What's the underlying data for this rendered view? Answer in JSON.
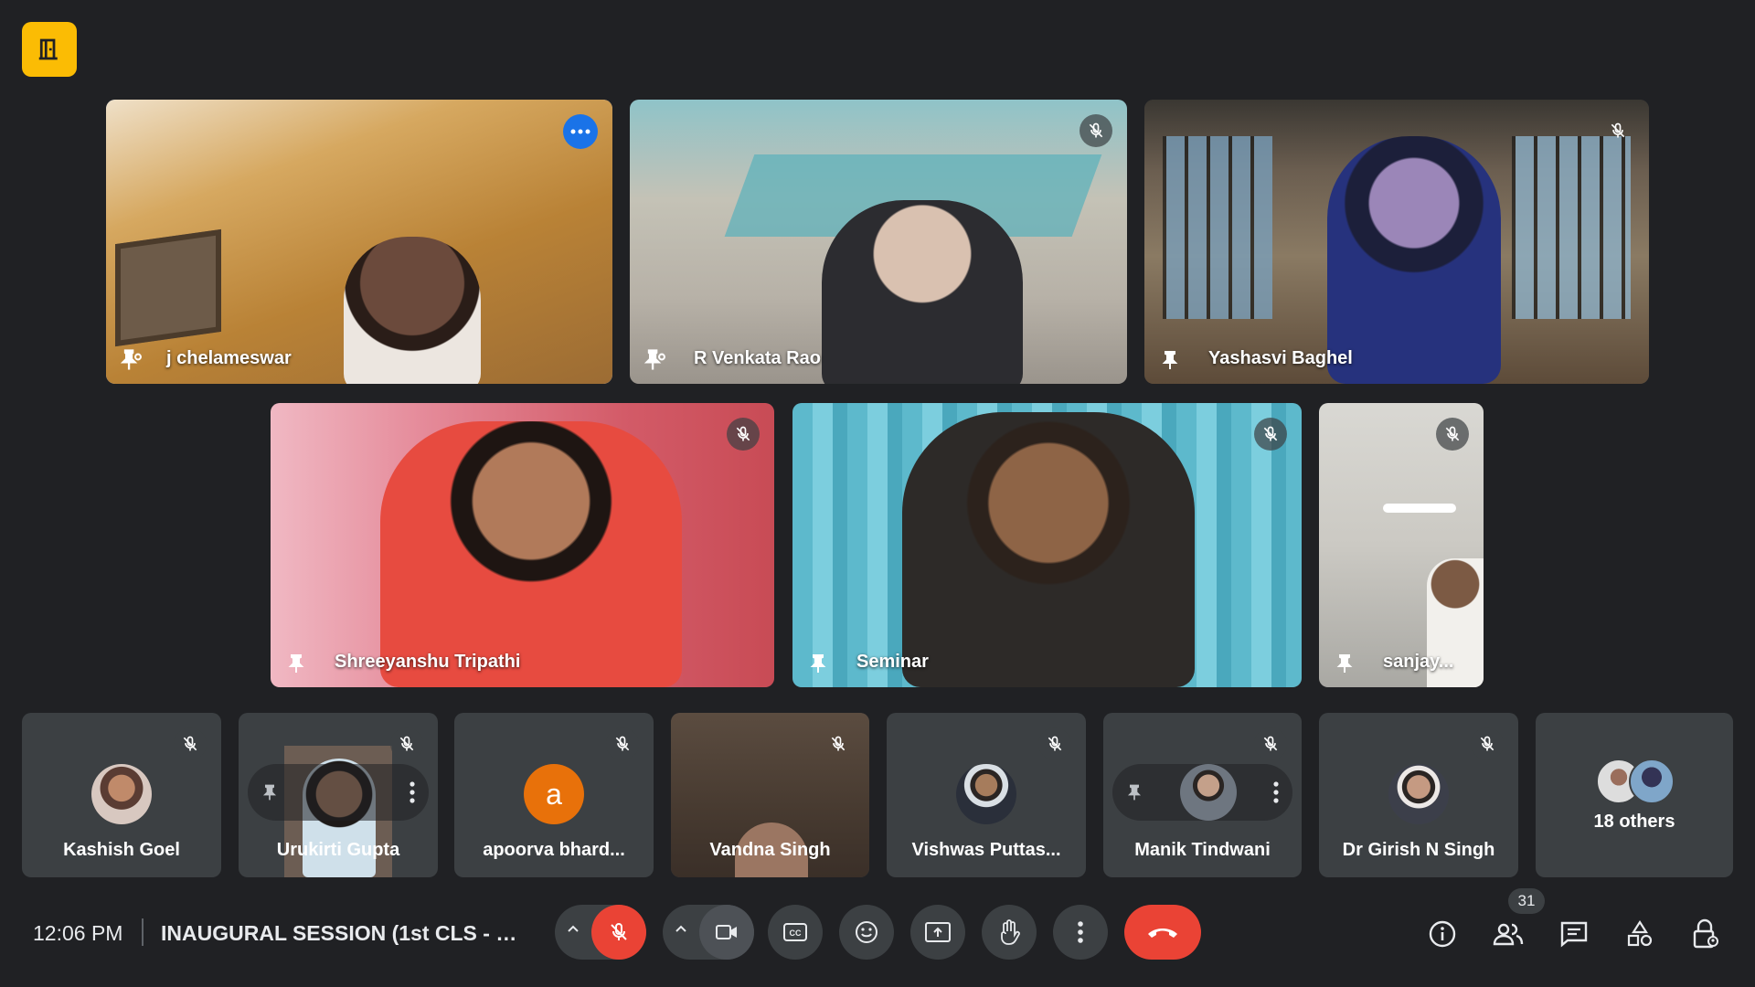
{
  "app": {
    "logo_icon": "activities-door-icon"
  },
  "stage": {
    "tiles": [
      {
        "name": "j chelameswar",
        "state": "speaking-active"
      },
      {
        "name": "R Venkata Rao",
        "state": "muted"
      },
      {
        "name": "Yashasvi Baghel",
        "state": "muted"
      },
      {
        "name": "Shreeyanshu Tripathi",
        "state": "muted"
      },
      {
        "name": "Seminar",
        "state": "muted"
      },
      {
        "name": "sanjay...",
        "state": "muted"
      }
    ]
  },
  "strip": {
    "tiles": [
      {
        "name": "Kashish Goel"
      },
      {
        "name": "Urukirti Gupta"
      },
      {
        "name": "apoorva bhard...",
        "avatar_letter": "a"
      },
      {
        "name": "Vandna Singh"
      },
      {
        "name": "Vishwas Puttas..."
      },
      {
        "name": "Manik Tindwani"
      },
      {
        "name": "Dr Girish N Singh"
      }
    ],
    "others_label": "18 others"
  },
  "bottom": {
    "time": "12:06 PM",
    "meeting_title": "INAUGURAL SESSION (1st CLS - L...",
    "participants_count": "31"
  },
  "colors": {
    "accent": "#8ab4f8",
    "danger": "#ea4335",
    "logo": "#fbbc04"
  }
}
